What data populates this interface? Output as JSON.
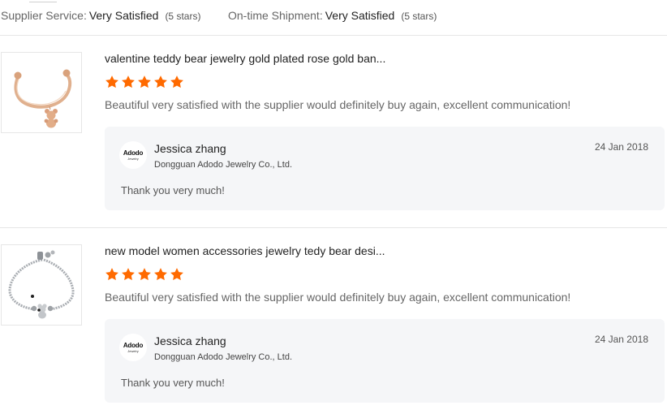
{
  "summary": {
    "supplier_service_label": "Supplier Service:",
    "supplier_service_value": "Very Satisfied",
    "supplier_service_stars": "(5 stars)",
    "shipment_label": "On-time Shipment:",
    "shipment_value": "Very Satisfied",
    "shipment_stars": "(5 stars)"
  },
  "colors": {
    "star": "#ff6a00",
    "reply_bg": "#f5f6f8",
    "divider": "#e6e6e6"
  },
  "reviews": [
    {
      "product_title": "valentine teddy bear jewelry gold plated rose gold ban...",
      "rating": 5,
      "comment": "Beautiful very satisfied with the supplier would definitely buy again, excellent communication!",
      "product_image": "rose-gold-bangle-teddy-charm",
      "reply": {
        "logo_text": "Adodo",
        "logo_sub": "Jewelry",
        "name": "Jessica zhang",
        "company": "Dongguan Adodo Jewelry Co., Ltd.",
        "date": "24 Jan 2018",
        "text": "Thank you very much!"
      }
    },
    {
      "product_title": "new model women accessories jewelry tedy bear desi...",
      "rating": 5,
      "comment": "Beautiful very satisfied with the supplier would definitely buy again, excellent communication!",
      "product_image": "silver-box-chain-bracelet-teddy-charm",
      "reply": {
        "logo_text": "Adodo",
        "logo_sub": "Jewelry",
        "name": "Jessica zhang",
        "company": "Dongguan Adodo Jewelry Co., Ltd.",
        "date": "24 Jan 2018",
        "text": "Thank you very much!"
      }
    }
  ]
}
